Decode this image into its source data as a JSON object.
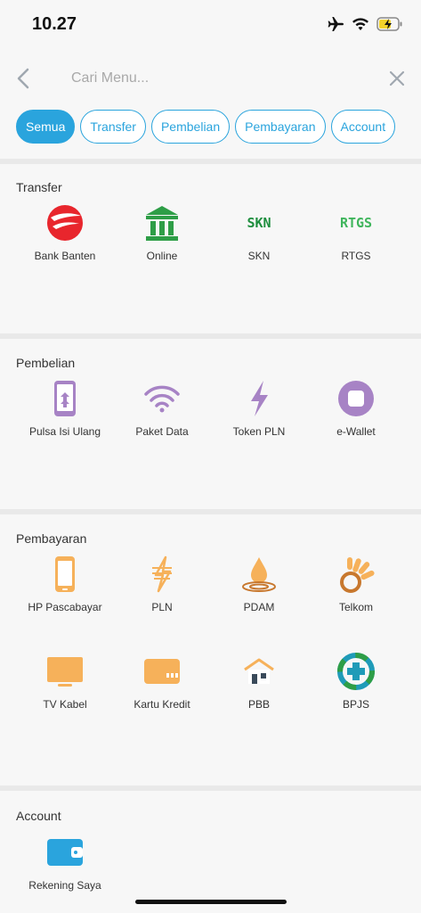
{
  "status": {
    "time": "10.27"
  },
  "search": {
    "placeholder": "Cari Menu..."
  },
  "tabs": [
    {
      "label": "Semua",
      "active": true
    },
    {
      "label": "Transfer"
    },
    {
      "label": "Pembelian"
    },
    {
      "label": "Pembayaran"
    },
    {
      "label": "Account"
    }
  ],
  "sections": {
    "transfer": {
      "title": "Transfer",
      "items": [
        {
          "label": "Bank Banten",
          "icon": "bank-banten-logo-icon"
        },
        {
          "label": "Online",
          "icon": "bank-building-icon"
        },
        {
          "label": "SKN",
          "icon": "skn-icon",
          "text": "SKN"
        },
        {
          "label": "RTGS",
          "icon": "rtgs-icon",
          "text": "RTGS"
        }
      ]
    },
    "pembelian": {
      "title": "Pembelian",
      "items": [
        {
          "label": "Pulsa Isi Ulang",
          "icon": "phone-topup-icon"
        },
        {
          "label": "Paket Data",
          "icon": "wifi-icon"
        },
        {
          "label": "Token PLN",
          "icon": "lightning-icon"
        },
        {
          "label": "e-Wallet",
          "icon": "ewallet-icon"
        }
      ]
    },
    "pembayaran": {
      "title": "Pembayaran",
      "items": [
        {
          "label": "HP Pascabayar",
          "icon": "mobile-phone-icon"
        },
        {
          "label": "PLN",
          "icon": "pln-icon"
        },
        {
          "label": "PDAM",
          "icon": "water-drop-icon"
        },
        {
          "label": "Telkom",
          "icon": "telkom-icon"
        },
        {
          "label": "TV Kabel",
          "icon": "tv-icon"
        },
        {
          "label": "Kartu Kredit",
          "icon": "credit-card-icon"
        },
        {
          "label": "PBB",
          "icon": "house-icon"
        },
        {
          "label": "BPJS",
          "icon": "bpjs-icon"
        }
      ]
    },
    "account": {
      "title": "Account",
      "items": [
        {
          "label": "Rekening Saya",
          "icon": "wallet-icon"
        }
      ]
    }
  },
  "colors": {
    "accent": "#2aa4dd",
    "transfer_green": "#2e9e47",
    "pembelian_purple": "#a783c5",
    "pembayaran_orange": "#f6b15a",
    "account_blue": "#2aa4dd"
  }
}
